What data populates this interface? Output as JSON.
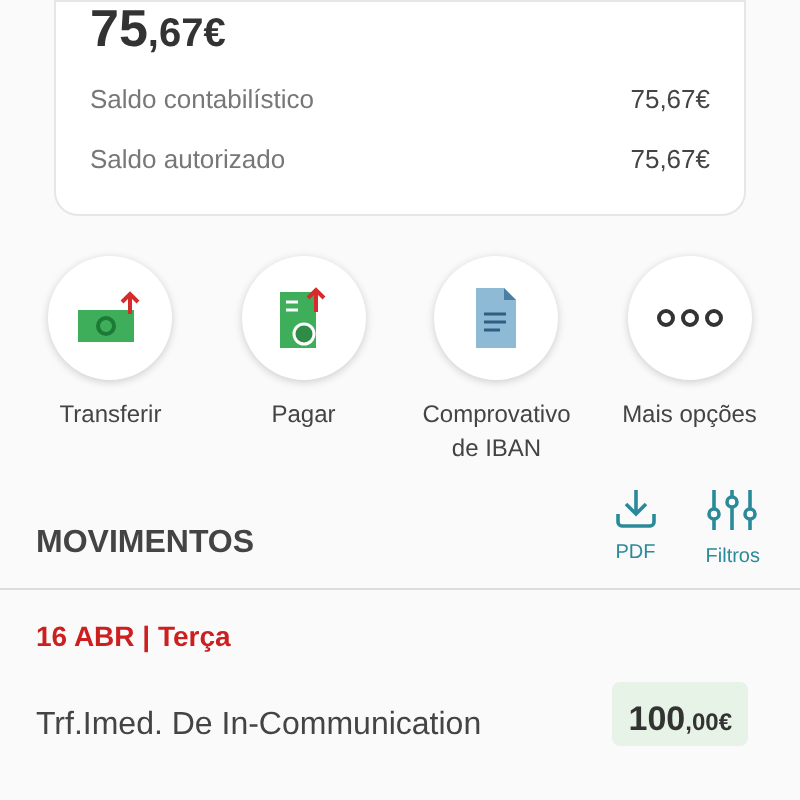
{
  "balance": {
    "integer": "75",
    "decimals": ",67€"
  },
  "balance_rows": [
    {
      "label": "Saldo contabilístico",
      "value": "75,67€"
    },
    {
      "label": "Saldo autorizado",
      "value": "75,67€"
    }
  ],
  "actions": [
    {
      "kind": "transfer",
      "label": "Transferir"
    },
    {
      "kind": "pay",
      "label": "Pagar"
    },
    {
      "kind": "document",
      "label": "Comprovativo de IBAN"
    },
    {
      "kind": "more",
      "label": "Mais opções"
    }
  ],
  "movements": {
    "title": "MOVIMENTOS",
    "tools": [
      {
        "kind": "download",
        "label": "PDF"
      },
      {
        "kind": "filter",
        "label": "Filtros"
      }
    ]
  },
  "date_header": "16 ABR | Terça",
  "transactions": [
    {
      "description": "Trf.Imed. De In-Communication",
      "amount": "100",
      "amount_decimals": ",00€"
    }
  ]
}
